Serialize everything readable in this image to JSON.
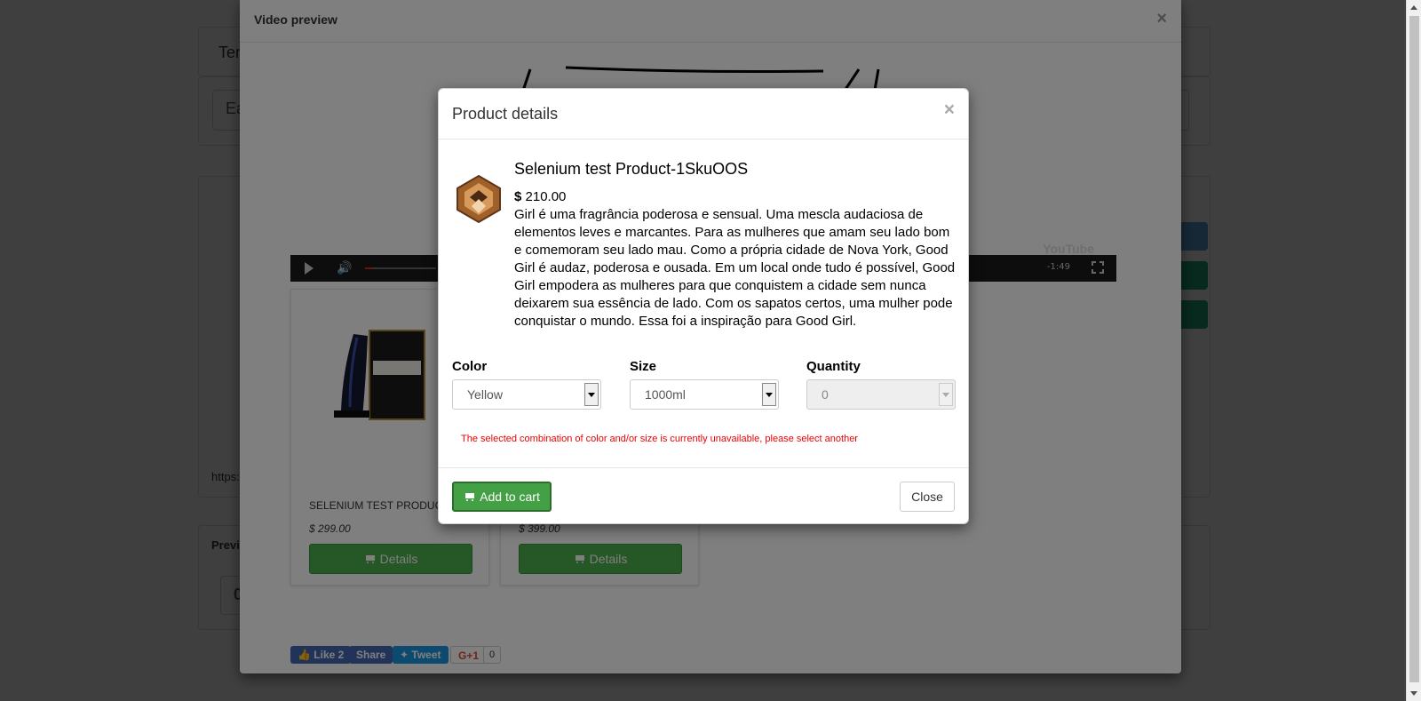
{
  "background": {
    "header_fragment": "Tem",
    "input_fragment": "Ea",
    "url_fragment": "https:",
    "preview_fragment": "Previ",
    "box_fragment": "0",
    "side_buttons": [
      "#5aa3d9",
      "#1fa67a",
      "#1fa67a"
    ]
  },
  "video_modal": {
    "title": "Video preview",
    "close": "×",
    "player": {
      "time": "-1:49",
      "watermark": "YouTube",
      "progress": 0.1
    }
  },
  "product_cards": [
    {
      "name": "SELENIUM TEST PRODUCT-",
      "price": "$ 299.00",
      "button": "Details"
    },
    {
      "name": "",
      "price": "$ 399.00",
      "button": "Details"
    }
  ],
  "social": {
    "like": "Like 2",
    "share": "Share",
    "tweet": "Tweet",
    "gplus": "G+1",
    "gplus_count": "0"
  },
  "product_modal": {
    "title": "Product details",
    "close": "×",
    "product_name": "Selenium test Product-1SkuOOS",
    "currency": "$",
    "price": "210.00",
    "description": "Girl é uma fragrância poderosa e sensual. Uma mescla audaciosa de elementos leves e marcantes. Para as mulheres que amam seu lado bom e comemoram seu lado mau. Como a própria cidade de Nova York, Good Girl é audaz, poderosa e ousada. Em um local onde tudo é possível, Good Girl empodera as mulheres para que conquistem a cidade sem nunca deixarem sua essência de lado. Com os sapatos certos, uma mulher pode conquistar o mundo. Essa foi a inspiração para Good Girl.",
    "color_label": "Color",
    "color_value": "Yellow",
    "size_label": "Size",
    "size_value": "1000ml",
    "quantity_label": "Quantity",
    "quantity_value": "0",
    "warning": "The selected combination of color and/or size is currently unavailable, please select another",
    "add_to_cart": "Add to cart",
    "close_button": "Close"
  }
}
